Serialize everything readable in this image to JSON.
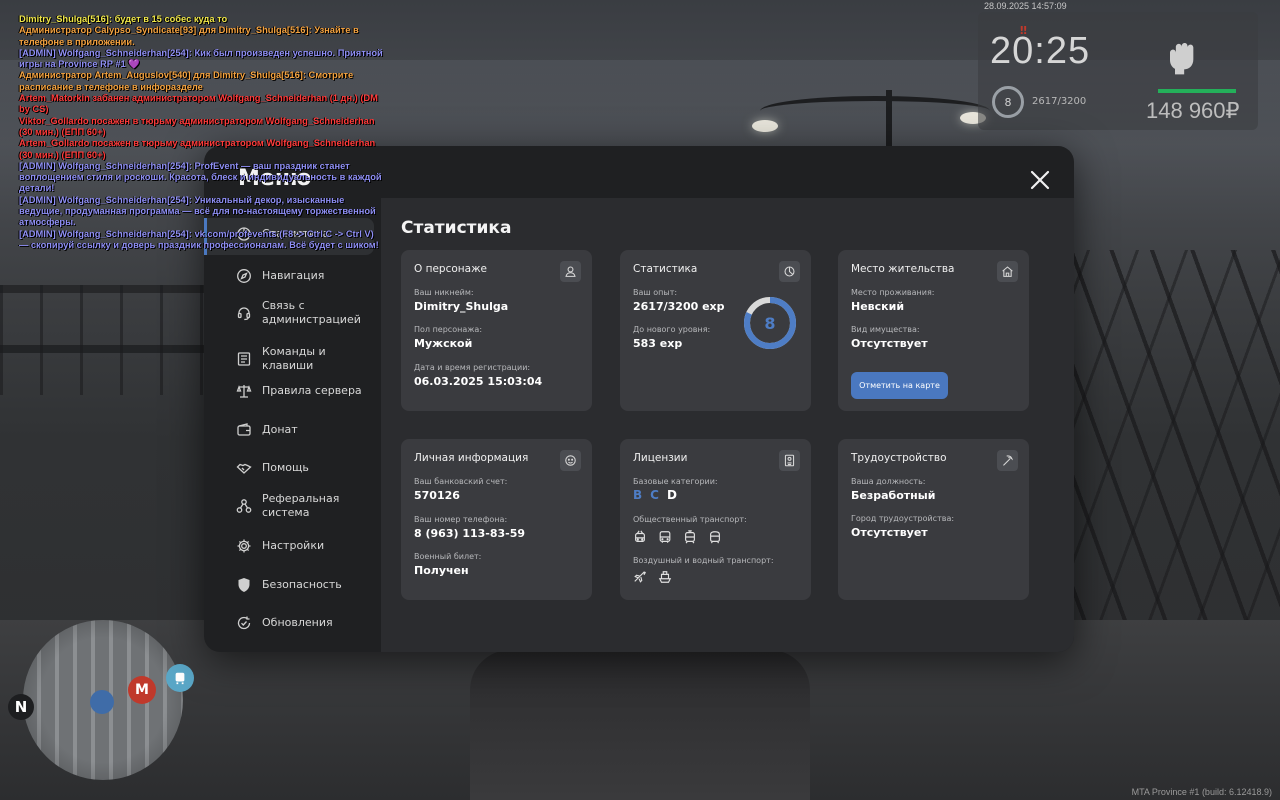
{
  "chat": [
    {
      "text": "Dimitry_Shulga[516]: будет в 15 собес куда  то",
      "color": "#f0e84a",
      "name_color": "#7be36a"
    },
    {
      "text": "Администратор Calypso_Syndicate[93] для Dimitry_Shulga[516]: Узнайте в телефоне в приложении.",
      "color": "#f5a340"
    },
    {
      "text": "[ADMIN] Wolfgang_Schneiderhan[254]: Кик был произведен успешно. Приятной игры на Province RP #1 💜",
      "color": "#8f8ff5"
    },
    {
      "text": "Администратор Artem_Auguslov[540] для Dimitry_Shulga[516]: Смотрите расписание в телефоне в инфоразделе",
      "color": "#f5a340"
    },
    {
      "text": "Artem_Matorkin забанен администратором Wolfgang_Schneiderhan (1 дн.) (DM by CS)",
      "color": "#ff3b3b"
    },
    {
      "text": "Viktor_Gollardo посажен в тюрьму администратором Wolfgang_Schneiderhan (30 мин.) (ЕПП 60+)",
      "color": "#ff3b3b"
    },
    {
      "text": "Artem_Gollardo посажен в тюрьму администратором Wolfgang_Schneiderhan (30 мин.) (ЕПП 60+)",
      "color": "#ff3b3b"
    },
    {
      "text": "[ADMIN] Wolfgang_Schneiderhan[254]: ProfEvent — ваш праздник станет воплощением стиля и роскоши. Красота, блеск и индивидуальность в каждой детали!",
      "color": "#8f8ff5"
    },
    {
      "text": "[ADMIN] Wolfgang_Schneiderhan[254]: Уникальный декор, изысканные ведущие, продуманная программа — всё для по-настоящему торжественной атмосферы.",
      "color": "#8f8ff5"
    },
    {
      "text": "[ADMIN] Wolfgang_Schneiderhan[254]: vk.com/profevents (F8 -> Ctrl C -> Ctrl V) — скопируй ссылку и доверь праздник профессионалам. Всё будет с шиком!",
      "color": "#8f8ff5"
    }
  ],
  "hud": {
    "datetime": "28.09.2025 14:57:09",
    "clock": "20:25",
    "level": "8",
    "exp": "2617/3200",
    "money": "148 960₽",
    "health_fraction": 1.0
  },
  "minimap": {
    "north": "N",
    "metro": "M"
  },
  "build_info": "MTA Province #1 (build: 6.12418.9)",
  "menu": {
    "title": "Меню",
    "sidebar": [
      {
        "label": "Статистика",
        "icon": "chart-icon",
        "active": true
      },
      {
        "label": "Навигация",
        "icon": "compass-icon"
      },
      {
        "label": "Связь с администрацией",
        "icon": "headset-icon"
      },
      {
        "label": "Команды и клавиши",
        "icon": "list-icon"
      },
      {
        "label": "Правила сервера",
        "icon": "scales-icon"
      },
      {
        "label": "Донат",
        "icon": "wallet-icon"
      },
      {
        "label": "Помощь",
        "icon": "handshake-icon"
      },
      {
        "label": "Реферальная система",
        "icon": "referral-icon"
      },
      {
        "label": "Настройки",
        "icon": "gear-icon"
      },
      {
        "label": "Безопасность",
        "icon": "shield-icon"
      },
      {
        "label": "Обновления",
        "icon": "update-icon"
      }
    ],
    "content_title": "Статистика",
    "cards": {
      "character": {
        "title": "О персонаже",
        "nickname_label": "Ваш никнейм:",
        "nickname": "Dimitry_Shulga",
        "gender_label": "Пол персонажа:",
        "gender": "Мужской",
        "reg_label": "Дата и время регистрации:",
        "reg": "06.03.2025 15:03:04"
      },
      "stats": {
        "title": "Статистика",
        "exp_label": "Ваш опыт:",
        "exp": "2617/3200 exp",
        "next_label": "До нового уровня:",
        "next": "583 exp",
        "level": "8",
        "progress": 0.818
      },
      "residence": {
        "title": "Место жительства",
        "place_label": "Место проживания:",
        "place": "Невский",
        "property_label": "Вид имущества:",
        "property": "Отсутствует",
        "button": "Отметить на карте"
      },
      "personal": {
        "title": "Личная информация",
        "bank_label": "Ваш банковский счет:",
        "bank": "570126",
        "phone_label": "Ваш номер телефона:",
        "phone": "8 (963) 113-83-59",
        "military_label": "Военный билет:",
        "military": "Получен"
      },
      "licenses": {
        "title": "Лицензии",
        "base_label": "Базовые категории:",
        "categories": [
          {
            "letter": "B",
            "owned": true
          },
          {
            "letter": "C",
            "owned": true
          },
          {
            "letter": "D",
            "owned": false
          }
        ],
        "public_label": "Общественный транспорт:",
        "public_icons": [
          "trolleybus-icon",
          "bus-icon",
          "tram-icon",
          "metro-icon"
        ],
        "air_label": "Воздушный и водный транспорт:",
        "air_icons": [
          "plane-icon",
          "boat-icon"
        ]
      },
      "job": {
        "title": "Трудоустройство",
        "position_label": "Ваша должность:",
        "position": "Безработный",
        "city_label": "Город трудоустройства:",
        "city": "Отсутствует"
      }
    }
  }
}
